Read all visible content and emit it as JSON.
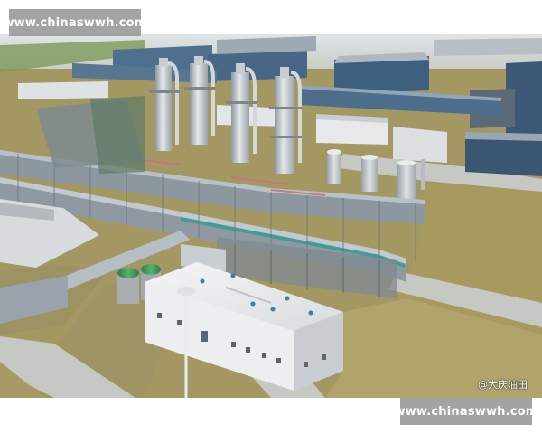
{
  "watermark_top": "www.chinaswwh.com",
  "watermark_bottom": "www.chinaswwh.com",
  "photo_credit": "@大庆油田",
  "colors": {
    "grass": "#a89a62",
    "pipe_gray": "#b9c1c8",
    "pipe_teal": "#3f9e95",
    "roof_white": "#eef0f1",
    "tank_green": "#3e9a57",
    "steel_blue": "#4f6f8e"
  }
}
